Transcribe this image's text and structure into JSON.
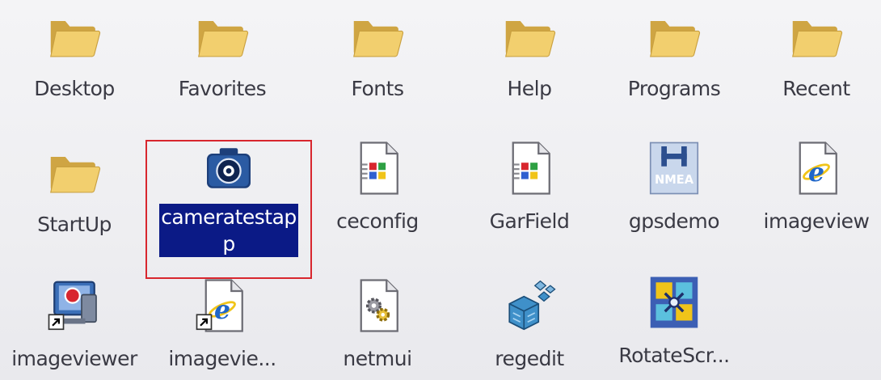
{
  "desktop": {
    "row1": [
      {
        "label": "Desktop",
        "icon": "folder-icon"
      },
      {
        "label": "Favorites",
        "icon": "folder-icon"
      },
      {
        "label": "Fonts",
        "icon": "folder-icon"
      },
      {
        "label": "Help",
        "icon": "folder-icon"
      },
      {
        "label": "Programs",
        "icon": "folder-icon"
      },
      {
        "label": "Recent",
        "icon": "folder-icon"
      }
    ],
    "row2": [
      {
        "label": "StartUp",
        "icon": "folder-icon"
      },
      {
        "label": "cameratestapp",
        "icon": "camera-icon",
        "selected": true
      },
      {
        "label": "ceconfig",
        "icon": "windows-app-file-icon"
      },
      {
        "label": "GarField",
        "icon": "windows-app-file-icon"
      },
      {
        "label": "gpsdemo",
        "icon": "nmea-icon",
        "icon_text": "NMEA"
      },
      {
        "label": "imageview",
        "icon": "internet-explorer-file-icon"
      }
    ],
    "row3": [
      {
        "label": "imageviewer",
        "icon": "computer-shortcut-icon"
      },
      {
        "label": "imagevie...",
        "icon": "internet-explorer-shortcut-icon"
      },
      {
        "label": "netmui",
        "icon": "gear-file-icon"
      },
      {
        "label": "regedit",
        "icon": "registry-cubes-icon"
      },
      {
        "label": "RotateScr...",
        "icon": "rotate-screen-icon"
      }
    ]
  },
  "colors": {
    "selection_bg": "#0b1a86",
    "highlight_frame": "#d8262e",
    "folder": "#f2cf6e",
    "background": "#f1f1f3"
  }
}
